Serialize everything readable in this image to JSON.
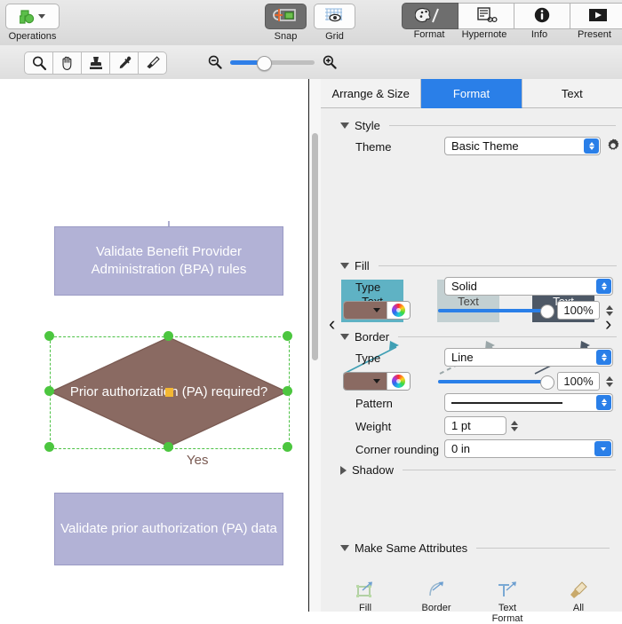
{
  "toolbar": {
    "operations": {
      "label": "Operations",
      "icon": "shape-operations-icon"
    },
    "snap": {
      "label": "Snap",
      "icon": "snap-icon",
      "active": true
    },
    "grid": {
      "label": "Grid",
      "icon": "grid-eye-icon",
      "active": false
    },
    "format": {
      "label": "Format",
      "icon": "palette-icon",
      "active": true
    },
    "hypernote": {
      "label": "Hypernote",
      "icon": "hypernote-icon",
      "active": false
    },
    "info": {
      "label": "Info",
      "icon": "info-circle-icon",
      "active": false
    },
    "present": {
      "label": "Present",
      "icon": "present-play-icon",
      "active": false
    }
  },
  "tools": [
    {
      "name": "zoom-tool",
      "icon": "magnifier-icon"
    },
    {
      "name": "pan-tool",
      "icon": "hand-icon"
    },
    {
      "name": "stamp-tool",
      "icon": "stamp-icon"
    },
    {
      "name": "eyedropper-tool",
      "icon": "eyedropper-icon"
    },
    {
      "name": "paintbrush-tool",
      "icon": "paintbrush-icon"
    }
  ],
  "zoom_control": {
    "zoom_out_icon": "magnifier-minus-icon",
    "zoom_in_icon": "magnifier-plus-icon",
    "value_percent": 38
  },
  "canvas": {
    "nodes": [
      {
        "id": "bpa-rules",
        "type": "process",
        "text": "Validate Benefit Provider Administration (BPA) rules",
        "fill": "#b2b2d6",
        "text_color": "#ffffff"
      },
      {
        "id": "pa-required",
        "type": "decision",
        "text": "Prior authorization (PA) required?",
        "fill": "#8a6a62",
        "text_color": "#ffffff",
        "selected": true
      },
      {
        "id": "validate-pa-data",
        "type": "process",
        "text": "Validate prior authorization (PA) data",
        "fill": "#b2b2d6",
        "text_color": "#ffffff"
      }
    ],
    "edges": [
      {
        "from": "bpa-rules",
        "to": "pa-required",
        "label": "",
        "color": "#9a9ac4"
      },
      {
        "from": "pa-required",
        "to": "validate-pa-data",
        "label": "Yes",
        "color": "#7a5a52"
      }
    ],
    "selection_color": "#4cc63f"
  },
  "panel": {
    "tabs": [
      {
        "id": "arrange-size",
        "label": "Arrange & Size",
        "active": false
      },
      {
        "id": "format",
        "label": "Format",
        "active": true
      },
      {
        "id": "text",
        "label": "Text",
        "active": false
      }
    ],
    "style": {
      "title": "Style",
      "expanded": true,
      "theme_label": "Theme",
      "theme_value": "Basic Theme",
      "gear_icon": "gear-icon",
      "prev_icon": "chevron-left-icon",
      "next_icon": "chevron-right-icon",
      "swatches": [
        {
          "label": "Text",
          "fill": "#5fb2c4",
          "text_color": "#111111",
          "arrow_color": "#3f9fb4",
          "arrow_style": "solid"
        },
        {
          "label": "Text",
          "fill": "#c3d0d2",
          "text_color": "#444444",
          "arrow_color": "#9aa6a8",
          "arrow_style": "dashed"
        },
        {
          "label": "Text",
          "fill": "#4d5866",
          "text_color": "#ffffff",
          "arrow_color": "#4d5866",
          "arrow_style": "solid"
        }
      ],
      "page_dots": 3,
      "active_dot": 1
    },
    "fill": {
      "title": "Fill",
      "expanded": true,
      "type_label": "Type",
      "type_value": "Solid",
      "color": "#8a6a62",
      "color_wheel_icon": "color-wheel-icon",
      "opacity_value": "100%"
    },
    "border": {
      "title": "Border",
      "expanded": true,
      "type_label": "Type",
      "type_value": "Line",
      "color": "#8a6a62",
      "color_wheel_icon": "color-wheel-icon",
      "opacity_value": "100%",
      "pattern_label": "Pattern",
      "pattern_value": "solid-line",
      "weight_label": "Weight",
      "weight_value": "1 pt",
      "corner_label": "Corner rounding",
      "corner_value": "0 in"
    },
    "shadow": {
      "title": "Shadow",
      "expanded": false
    },
    "make_same": {
      "title": "Make Same Attributes",
      "expanded": true,
      "buttons": [
        {
          "id": "fill",
          "label": "Fill",
          "icon": "fill-same-icon"
        },
        {
          "id": "border",
          "label": "Border",
          "icon": "border-same-icon"
        },
        {
          "id": "text-format",
          "label": "Text Format",
          "icon": "text-format-same-icon"
        },
        {
          "id": "all",
          "label": "All",
          "icon": "all-same-icon"
        }
      ]
    }
  }
}
